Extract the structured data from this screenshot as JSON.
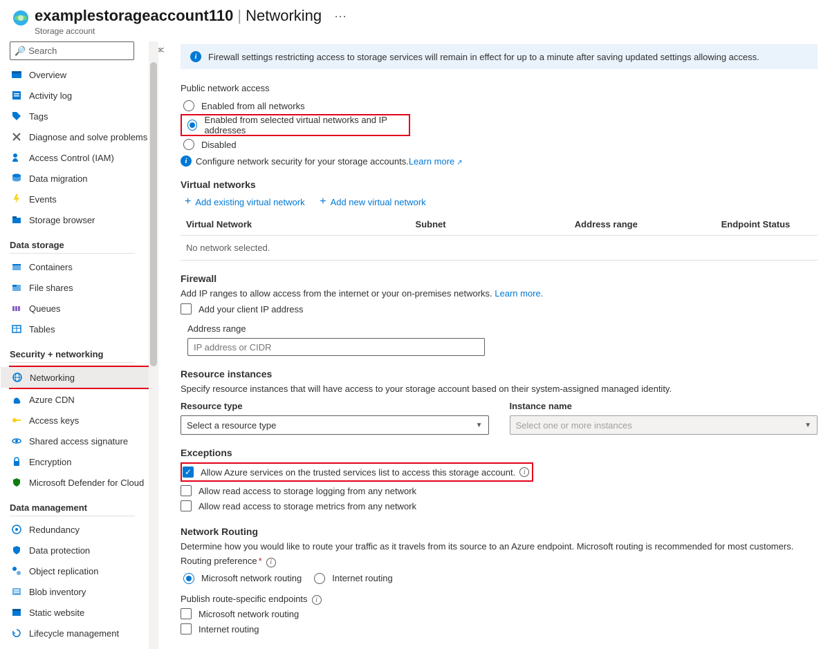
{
  "header": {
    "resource_name": "examplestorageaccount110",
    "page_title": "Networking",
    "resource_type": "Storage account",
    "more": "···"
  },
  "sidebar": {
    "search_placeholder": "Search",
    "items": {
      "overview": "Overview",
      "activity_log": "Activity log",
      "tags": "Tags",
      "diagnose": "Diagnose and solve problems",
      "access_control": "Access Control (IAM)",
      "data_migration": "Data migration",
      "events": "Events",
      "storage_browser": "Storage browser"
    },
    "group_data_storage": "Data storage",
    "data_storage": {
      "containers": "Containers",
      "file_shares": "File shares",
      "queues": "Queues",
      "tables": "Tables"
    },
    "group_security": "Security + networking",
    "security": {
      "networking": "Networking",
      "azure_cdn": "Azure CDN",
      "access_keys": "Access keys",
      "sas": "Shared access signature",
      "encryption": "Encryption",
      "defender": "Microsoft Defender for Cloud"
    },
    "group_data_mgmt": "Data management",
    "data_mgmt": {
      "redundancy": "Redundancy",
      "data_protection": "Data protection",
      "object_replication": "Object replication",
      "blob_inventory": "Blob inventory",
      "static_website": "Static website",
      "lifecycle": "Lifecycle management"
    }
  },
  "banner": {
    "text": "Firewall settings restricting access to storage services will remain in effect for up to a minute after saving updated settings allowing access."
  },
  "public_access": {
    "label": "Public network access",
    "opt_all": "Enabled from all networks",
    "opt_selected": "Enabled from selected virtual networks and IP addresses",
    "opt_disabled": "Disabled",
    "config_text": "Configure network security for your storage accounts. ",
    "learn_more": "Learn more"
  },
  "vnet": {
    "heading": "Virtual networks",
    "add_existing": "Add existing virtual network",
    "add_new": "Add new virtual network",
    "col_vnet": "Virtual Network",
    "col_subnet": "Subnet",
    "col_range": "Address range",
    "col_status": "Endpoint Status",
    "empty": "No network selected."
  },
  "firewall": {
    "heading": "Firewall",
    "desc": "Add IP ranges to allow access from the internet or your on-premises networks. ",
    "learn_more": "Learn more.",
    "add_client": "Add your client IP address",
    "addr_range_label": "Address range",
    "addr_placeholder": "IP address or CIDR"
  },
  "resource_instances": {
    "heading": "Resource instances",
    "desc": "Specify resource instances that will have access to your storage account based on their system-assigned managed identity.",
    "col_type": "Resource type",
    "col_name": "Instance name",
    "type_placeholder": "Select a resource type",
    "name_placeholder": "Select one or more instances"
  },
  "exceptions": {
    "heading": "Exceptions",
    "trusted": "Allow Azure services on the trusted services list to access this storage account.",
    "logging": "Allow read access to storage logging from any network",
    "metrics": "Allow read access to storage metrics from any network"
  },
  "routing": {
    "heading": "Network Routing",
    "desc": "Determine how you would like to route your traffic as it travels from its source to an Azure endpoint. Microsoft routing is recommended for most customers.",
    "pref_label": "Routing preference",
    "opt_ms": "Microsoft network routing",
    "opt_internet": "Internet routing",
    "publish_label": "Publish route-specific endpoints",
    "pub_ms": "Microsoft network routing",
    "pub_internet": "Internet routing"
  }
}
